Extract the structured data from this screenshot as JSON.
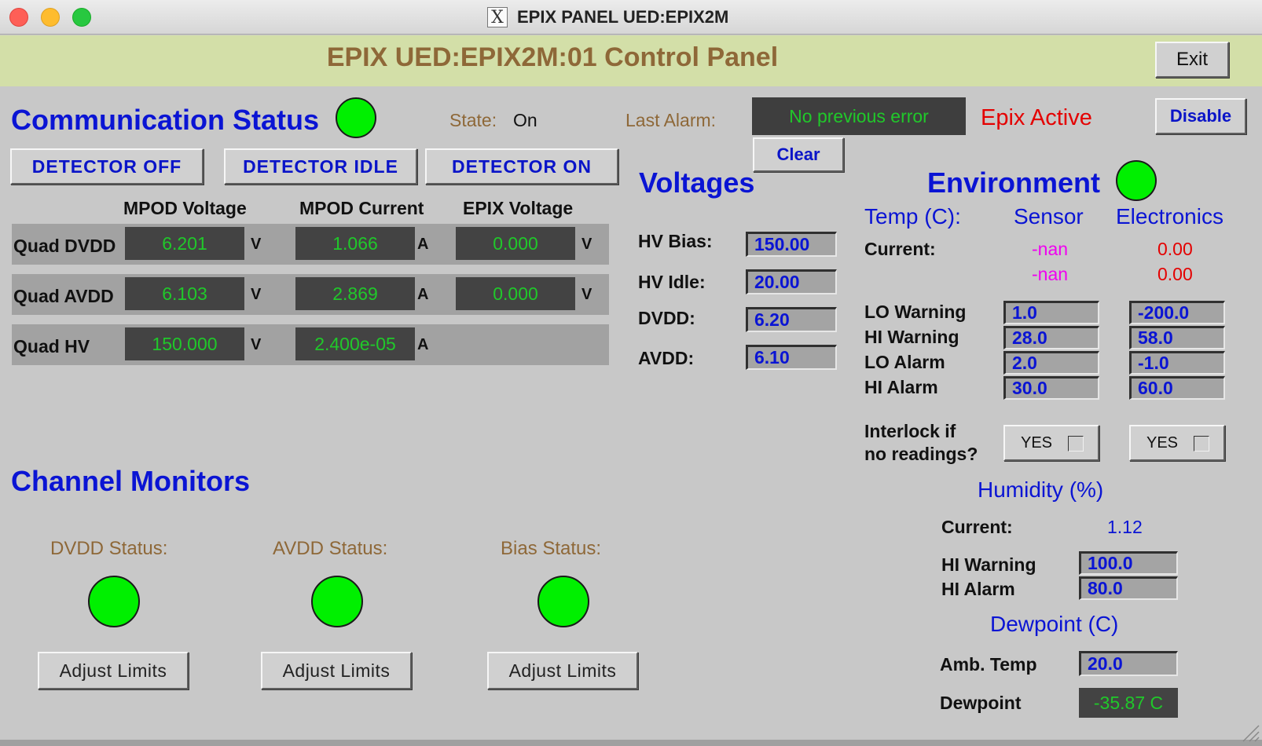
{
  "window": {
    "title": "EPIX PANEL UED:EPIX2M",
    "x_glyph": "X"
  },
  "header": {
    "title": "EPIX UED:EPIX2M:01 Control Panel",
    "exit_label": "Exit"
  },
  "comm": {
    "title": "Communication Status",
    "state_label": "State:",
    "state_value": "On",
    "last_alarm_label": "Last Alarm:",
    "last_alarm_value": "No previous error",
    "clear_label": "Clear",
    "epix_active": "Epix Active",
    "disable_label": "Disable",
    "buttons": {
      "off": "DETECTOR OFF",
      "idle": "DETECTOR IDLE",
      "on": "DETECTOR ON"
    }
  },
  "table": {
    "headers": [
      "MPOD Voltage",
      "MPOD Current",
      "EPIX Voltage"
    ],
    "rows": [
      {
        "name": "Quad DVDD",
        "mpod_v": "6.201",
        "mpod_v_unit": "V",
        "mpod_i": "1.066",
        "mpod_i_unit": "A",
        "epix_v": "0.000",
        "epix_v_unit": "V"
      },
      {
        "name": "Quad AVDD",
        "mpod_v": "6.103",
        "mpod_v_unit": "V",
        "mpod_i": "2.869",
        "mpod_i_unit": "A",
        "epix_v": "0.000",
        "epix_v_unit": "V"
      },
      {
        "name": "Quad HV",
        "mpod_v": "150.000",
        "mpod_v_unit": "V",
        "mpod_i": "2.400e-05",
        "mpod_i_unit": "A"
      }
    ]
  },
  "voltages": {
    "title": "Voltages",
    "hv_bias_label": "HV Bias:",
    "hv_bias": "150.00",
    "hv_idle_label": "HV Idle:",
    "hv_idle": "20.00",
    "dvdd_label": "DVDD:",
    "dvdd": "6.20",
    "avdd_label": "AVDD:",
    "avdd": "6.10"
  },
  "environment": {
    "title": "Environment",
    "temp_label": "Temp (C):",
    "sensor_label": "Sensor",
    "electronics_label": "Electronics",
    "current_label": "Current:",
    "sensor_current_1": "-nan",
    "sensor_current_2": "-nan",
    "elec_current_1": "0.00",
    "elec_current_2": "0.00",
    "lo_warning_label": "LO Warning",
    "hi_warning_label": "HI Warning",
    "lo_alarm_label": "LO Alarm",
    "hi_alarm_label": "HI Alarm",
    "sensor_lo_warning": "1.0",
    "sensor_hi_warning": "28.0",
    "sensor_lo_alarm": "2.0",
    "sensor_hi_alarm": "30.0",
    "elec_lo_warning": "-200.0",
    "elec_hi_warning": "58.0",
    "elec_lo_alarm": "-1.0",
    "elec_hi_alarm": "60.0",
    "interlock_label_1": "Interlock if",
    "interlock_label_2": "no readings?",
    "sensor_interlock": "YES",
    "elec_interlock": "YES"
  },
  "humidity": {
    "title": "Humidity (%)",
    "current_label": "Current:",
    "current_value": "1.12",
    "hi_warning_label": "HI Warning",
    "hi_alarm_label": "HI Alarm",
    "hi_warning": "100.0",
    "hi_alarm": "80.0"
  },
  "dewpoint": {
    "title": "Dewpoint (C)",
    "amb_temp_label": "Amb. Temp",
    "amb_temp": "20.0",
    "dewpoint_label": "Dewpoint",
    "dewpoint_value": "-35.87 C"
  },
  "channel_monitors": {
    "title": "Channel Monitors",
    "dvdd_status": "DVDD Status:",
    "avdd_status": "AVDD Status:",
    "bias_status": "Bias Status:",
    "adjust_label": "Adjust Limits"
  },
  "colors": {
    "led_ok": "#00f000",
    "title_blue": "#0a14d4",
    "label_brown": "#8e6838",
    "readout_green": "#20c82a",
    "alert_red": "#e40000"
  }
}
